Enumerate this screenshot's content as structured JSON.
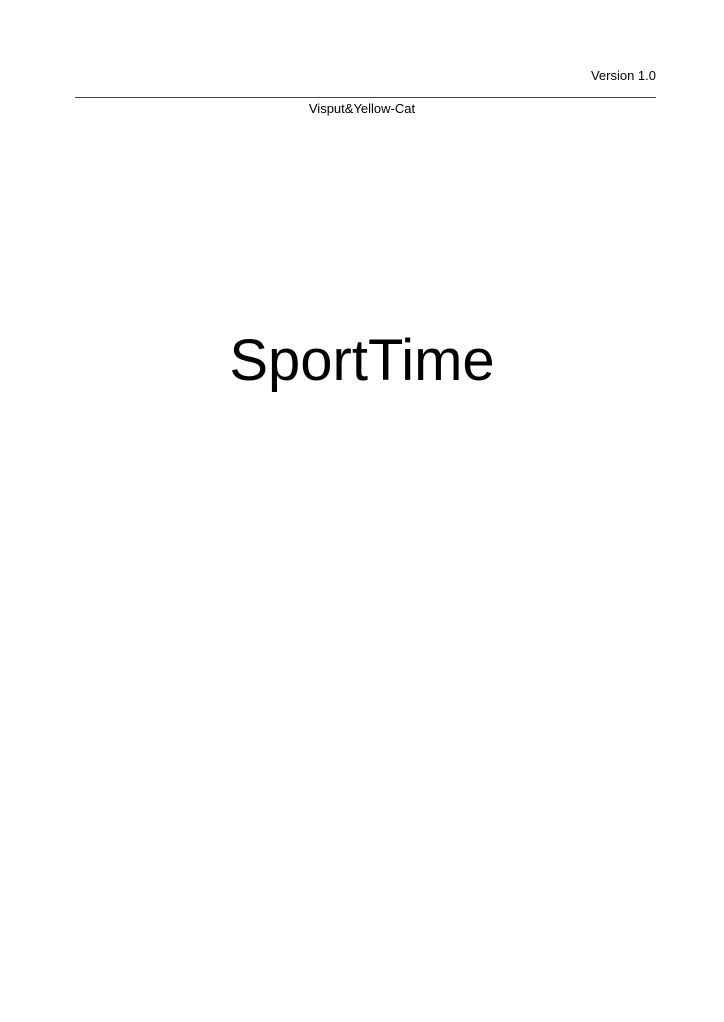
{
  "header": {
    "version": "Version 1.0",
    "authors": "Visput&Yellow-Cat"
  },
  "cover": {
    "title": "SportTime"
  }
}
